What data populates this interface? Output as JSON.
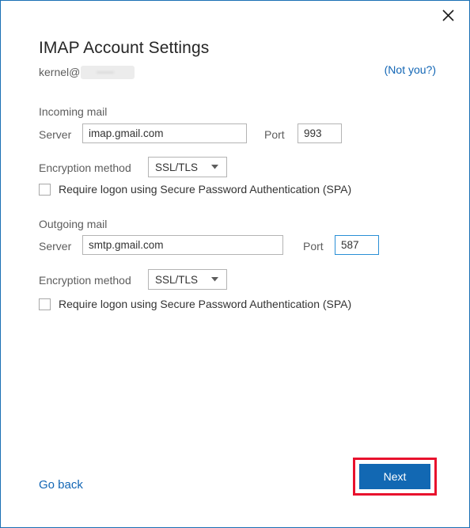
{
  "window": {
    "close_icon": "close-icon",
    "border_color": "#1a6fb4"
  },
  "header": {
    "title": "IMAP Account Settings",
    "account_name": "kernel@",
    "account_domain_redacted": "",
    "not_you_label": "(Not you?)",
    "link_color": "#1266b5"
  },
  "incoming": {
    "section_label": "Incoming mail",
    "server_label": "Server",
    "server_value": "imap.gmail.com",
    "server_placeholder": "",
    "port_label": "Port",
    "port_value": "993",
    "port_placeholder": "",
    "encryption_label": "Encryption method",
    "encryption_value": "SSL/TLS",
    "spa_label": "Require logon using Secure Password Authentication (SPA)",
    "spa_checked": false
  },
  "outgoing": {
    "section_label": "Outgoing mail",
    "server_label": "Server",
    "server_value": "smtp.gmail.com",
    "server_placeholder": "",
    "port_label": "Port",
    "port_value": "587",
    "port_placeholder": "",
    "encryption_label": "Encryption method",
    "encryption_value": "SSL/TLS",
    "spa_label": "Require logon using Secure Password Authentication (SPA)",
    "spa_checked": false
  },
  "footer": {
    "go_back_label": "Go back",
    "next_label": "Next",
    "next_button_color": "#1268b3",
    "highlight_color": "#e8112d"
  }
}
